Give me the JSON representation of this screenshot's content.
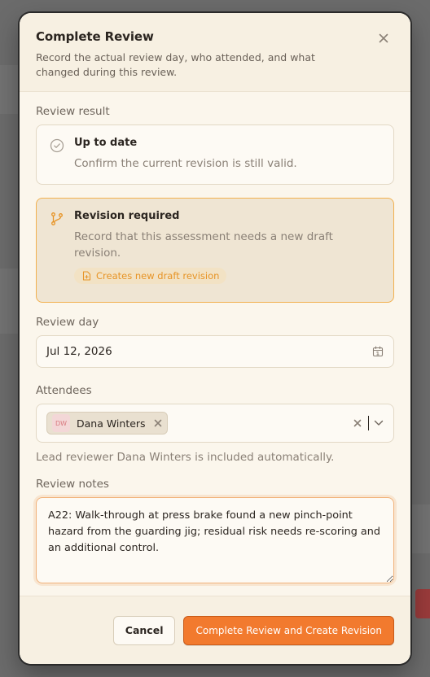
{
  "colors": {
    "accent": "#f27a2e",
    "selected_border": "#f2b04e",
    "badge_text": "#e79426",
    "surface": "#fbf6ec"
  },
  "dialog": {
    "title": "Complete Review",
    "description": "Record the actual review day, who attended, and what changed during this review.",
    "close_icon": "close-icon"
  },
  "review_result": {
    "label": "Review result",
    "options": [
      {
        "title": "Up to date",
        "description": "Confirm the current revision is still valid.",
        "icon": "check-circle-icon",
        "selected": false
      },
      {
        "title": "Revision required",
        "description": "Record that this assessment needs a new draft revision.",
        "icon": "git-branch-icon",
        "selected": true,
        "badge": "Creates new draft revision",
        "badge_icon": "file-plus-icon"
      }
    ]
  },
  "review_day": {
    "label": "Review day",
    "value": "Jul 12, 2026",
    "icon": "calendar-icon"
  },
  "attendees": {
    "label": "Attendees",
    "chips": [
      {
        "initials": "DW",
        "name": "Dana Winters"
      }
    ],
    "helper": "Lead reviewer Dana Winters is included automatically."
  },
  "review_notes": {
    "label": "Review notes",
    "value": "A22: Walk-through at press brake found a new pinch-point hazard from the guarding jig; residual risk needs re-scoring and an additional control."
  },
  "footer": {
    "cancel_label": "Cancel",
    "submit_label": "Complete Review and Create Revision"
  }
}
